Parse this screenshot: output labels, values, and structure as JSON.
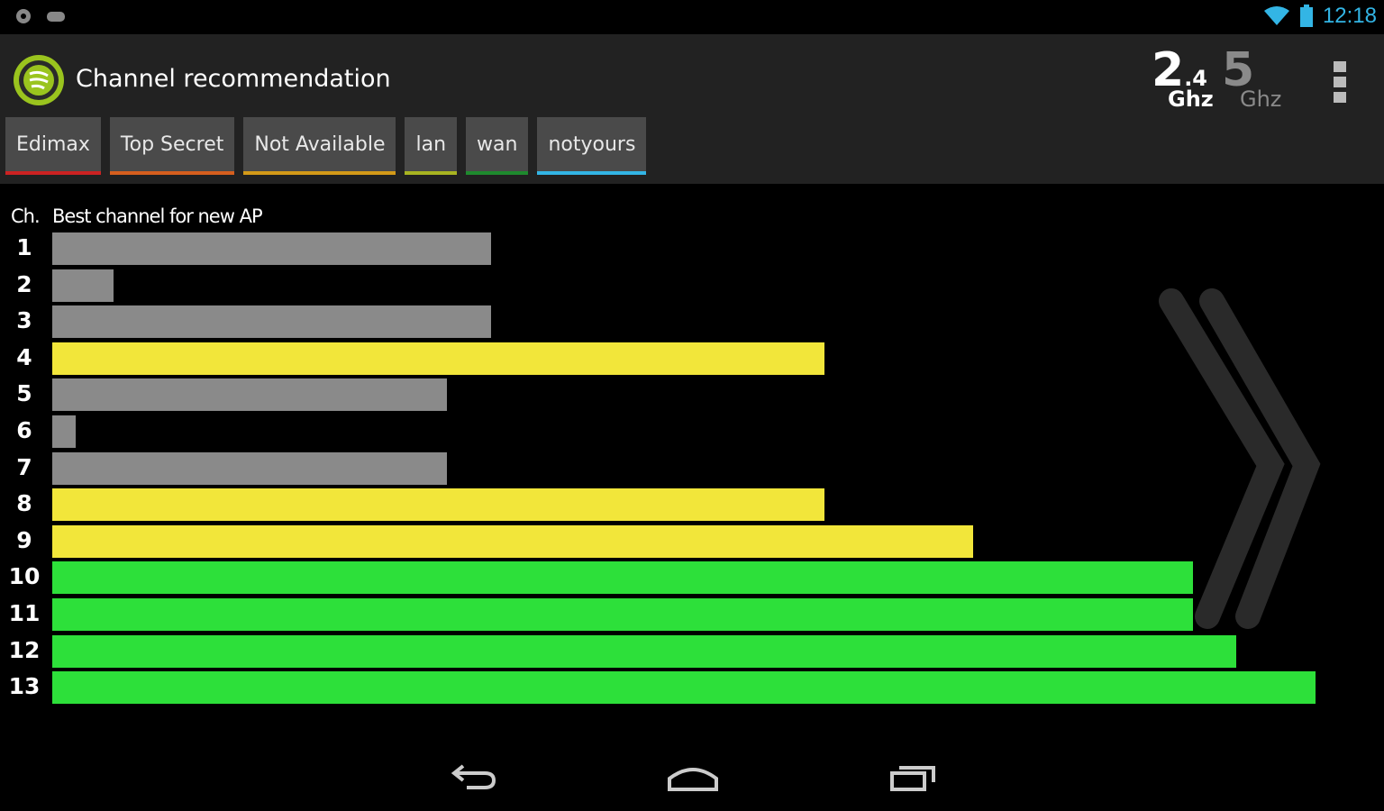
{
  "status_bar": {
    "time": "12:18",
    "icons": [
      "notification-icon",
      "game-controller-icon",
      "wifi-icon",
      "battery-icon"
    ],
    "accent_color": "#33b5e5"
  },
  "action_bar": {
    "title": "Channel recommendation",
    "band_24": {
      "main": "2",
      "sub": ".4",
      "unit": "Ghz"
    },
    "band_5": {
      "main": "5",
      "unit": "Ghz"
    },
    "selected_band": "2.4 Ghz"
  },
  "tabs": [
    {
      "label": "Edimax",
      "color": "#cc2222"
    },
    {
      "label": "Top Secret",
      "color": "#d65f1e"
    },
    {
      "label": "Not Available",
      "color": "#d49a18"
    },
    {
      "label": "lan",
      "color": "#a8b421"
    },
    {
      "label": "wan",
      "color": "#1e8a2e"
    },
    {
      "label": "notyours",
      "color": "#33b5e5"
    }
  ],
  "chart_data": {
    "type": "bar",
    "orientation": "horizontal",
    "ch_header": "Ch.",
    "title": "Best channel for new AP",
    "categories": [
      "1",
      "2",
      "3",
      "4",
      "5",
      "6",
      "7",
      "8",
      "9",
      "10",
      "11",
      "12",
      "13"
    ],
    "values": [
      5,
      0.7,
      5,
      8.8,
      4.5,
      0,
      4.5,
      8.8,
      10.5,
      13,
      13,
      13.5,
      14.4
    ],
    "xlim": [
      0,
      14.4
    ],
    "colors": [
      "#8a8a8a",
      "#8a8a8a",
      "#8a8a8a",
      "#f2e63a",
      "#8a8a8a",
      "#8a8a8a",
      "#8a8a8a",
      "#f2e63a",
      "#f2e63a",
      "#2de03a",
      "#2de03a",
      "#2de03a",
      "#2de03a"
    ],
    "grid": false
  },
  "nav_bar": {
    "icons": [
      "back-icon",
      "home-icon",
      "recent-apps-icon"
    ]
  }
}
